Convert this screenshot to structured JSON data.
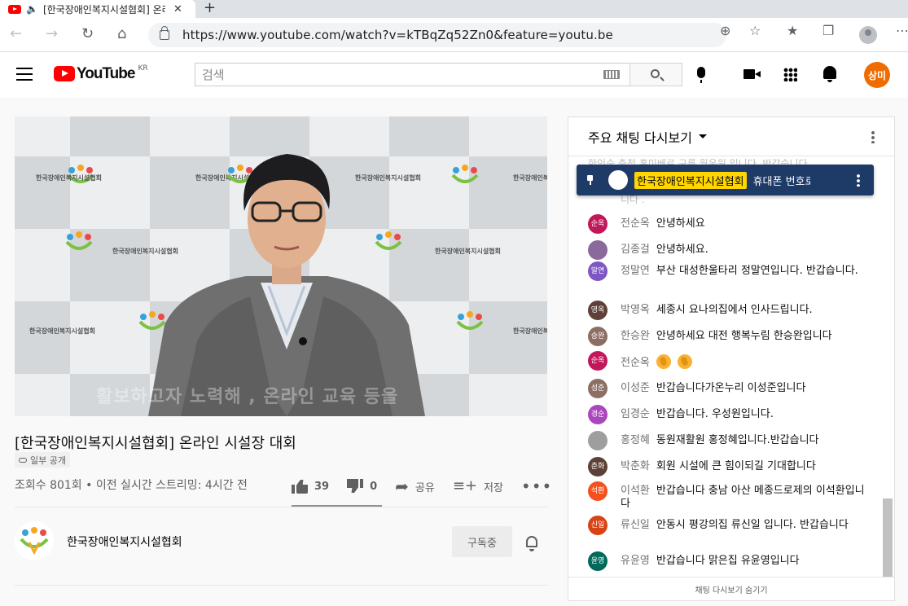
{
  "browser": {
    "tab_title": "[한국장애인복지시설협회] 온라인 시설장 대회",
    "url": "https://www.youtube.com/watch?v=kTBqZq52Zn0&feature=youtu.be"
  },
  "masthead": {
    "logo_text": "YouTube",
    "country": "KR",
    "search_placeholder": "검색",
    "avatar_label": "상미"
  },
  "video": {
    "watermark": "한국장애인복지시설협회",
    "burned_subtitle": "활보하고자 노력해 , 온라인 교육 등을",
    "title": "[한국장애인복지시설협회] 온라인 시설장 대회",
    "visibility": "일부 공개",
    "stats": "조회수 801회 • 이전 실시간 스트리밍: 4시간 전",
    "likes": "39",
    "dislikes": "0",
    "share_label": "공유",
    "save_label": "저장"
  },
  "channel": {
    "name": "한국장애인복지시설협회",
    "subscribe_label": "구독중"
  },
  "chat": {
    "header_title": "주요 채팅 다시보기",
    "ghost_top": "한인숙  충청 홍미베로 구름 월운원 입니다. 반갑습니다",
    "ghost_bottom": "니다 .",
    "pinned": {
      "author": "한국장애인복지시설협회",
      "text": "휴대폰 번호로 참여해주세요"
    },
    "messages": [
      {
        "initial": "순옥",
        "color": "#c2185b",
        "author": "전순옥",
        "text": "안녕하세요"
      },
      {
        "initial": "",
        "color": "#8a6a9a",
        "author": "김종걸",
        "text": "안녕하세요."
      },
      {
        "initial": "말연",
        "color": "#7e57c2",
        "author": "정말연",
        "text": "부산 대성한울타리 정말연입니다. 반갑습니다."
      },
      {
        "initial": "영옥",
        "color": "#5d4037",
        "author": "박영옥",
        "text": "세종시 요나의집에서 인사드립니다."
      },
      {
        "initial": "승완",
        "color": "#8d6e63",
        "author": "한승완",
        "text": "안녕하세요 대전 행복누림 한승완입니다"
      },
      {
        "initial": "순옥",
        "color": "#c2185b",
        "author": "전순옥",
        "text": ""
      },
      {
        "initial": "성준",
        "color": "#8d6e63",
        "author": "이성준",
        "text": "반갑습니다가온누리 이성준입니다"
      },
      {
        "initial": "경순",
        "color": "#ab47bc",
        "author": "임경순",
        "text": "반갑습니다. 우성원입니다."
      },
      {
        "initial": "",
        "color": "#9e9e9e",
        "author": "홍정혜",
        "text": "동원재활원 홍정혜입니다.반갑습니다"
      },
      {
        "initial": "춘화",
        "color": "#5d4037",
        "author": "박춘화",
        "text": "회원 시설에 큰 힘이되길 기대합니다"
      },
      {
        "initial": "석환",
        "color": "#f4511e",
        "author": "이석환",
        "text": "반갑습니다 충남 아산 메종드로제의 이석환입니다"
      },
      {
        "initial": "신일",
        "color": "#d84315",
        "author": "류신일",
        "text": "안동시 평강의집 류신일 입니다. 반갑습니다"
      },
      {
        "initial": "윤영",
        "color": "#00695c",
        "author": "유윤영",
        "text": "반갑습니다 맑은집 유윤영입니다"
      }
    ],
    "footer": "채팅 다시보기 숨기기"
  }
}
